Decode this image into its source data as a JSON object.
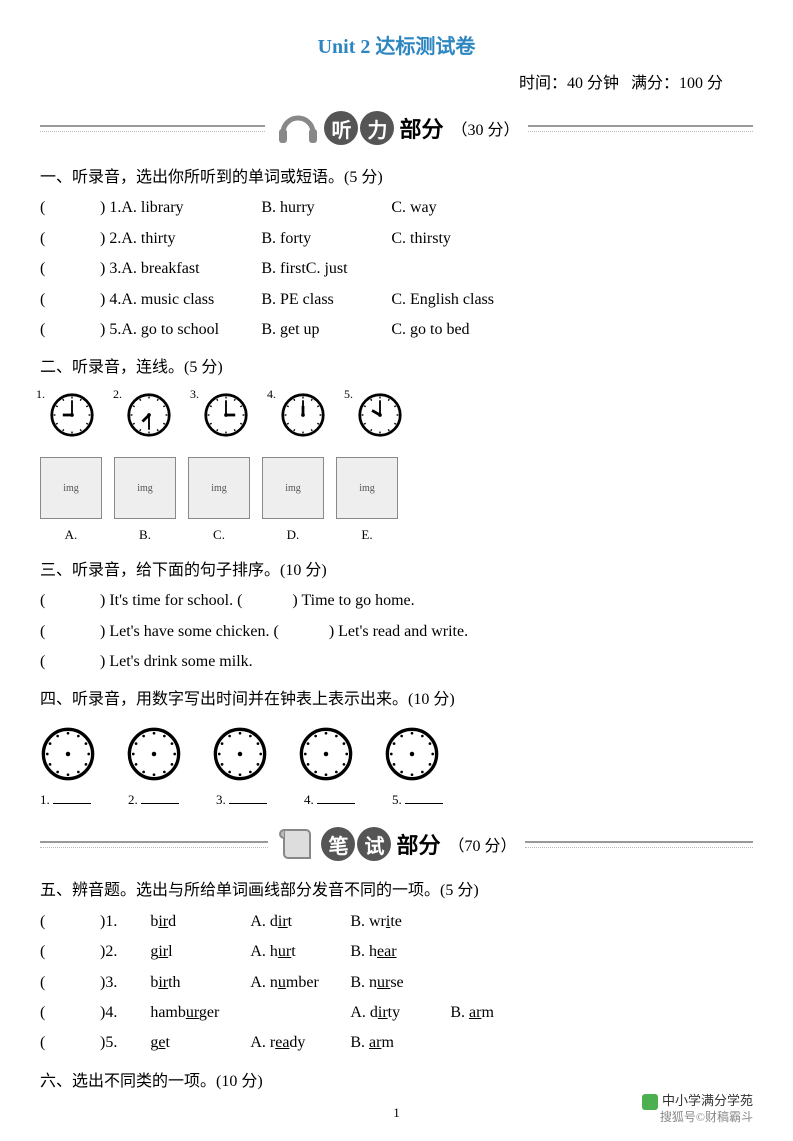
{
  "title": "Unit 2 达标测试卷",
  "meta": {
    "time_label": "时间：40 分钟",
    "score_label": "满分：100 分"
  },
  "listening": {
    "heading_bubbles": [
      "听",
      "力"
    ],
    "heading_text": "部分",
    "heading_points": "（30 分）",
    "q1": {
      "instruction": "一、听录音，选出你所听到的单词或短语。(5 分)",
      "items": [
        {
          "num": "1.",
          "a": "A. library",
          "b": "B. hurry",
          "c": "C. way"
        },
        {
          "num": "2.",
          "a": "A. thirty",
          "b": "B. forty",
          "c": "C. thirsty"
        },
        {
          "num": "3.",
          "a": "A. breakfast",
          "b": "B. firstC. just",
          "c": ""
        },
        {
          "num": "4.",
          "a": "A. music class",
          "b": "B. PE class",
          "c": "C. English class"
        },
        {
          "num": "5.",
          "a": "A. go to school",
          "b": "B. get up",
          "c": "C. go to bed"
        }
      ]
    },
    "q2": {
      "instruction": "二、听录音，连线。(5 分)",
      "clock_labels": [
        "1.",
        "2.",
        "3.",
        "4.",
        "5."
      ],
      "clock_times": [
        "9:00",
        "7:30",
        "3:00",
        "12:00",
        "10:00"
      ],
      "pic_labels": [
        "A.",
        "B.",
        "C.",
        "D.",
        "E."
      ]
    },
    "q3": {
      "instruction": "三、听录音，给下面的句子排序。(10 分)",
      "lines": [
        [
          ") It's time for school.  (",
          ") Time to go home."
        ],
        [
          ") Let's have some chicken.  (",
          ") Let's read and write."
        ],
        [
          ") Let's drink some milk."
        ]
      ]
    },
    "q4": {
      "instruction": "四、听录音，用数字写出时间并在钟表上表示出来。(10 分)",
      "num_labels": [
        "1.",
        "2.",
        "3.",
        "4.",
        "5."
      ]
    }
  },
  "written": {
    "heading_bubbles": [
      "笔",
      "试"
    ],
    "heading_text": "部分",
    "heading_points": "（70 分）",
    "q5": {
      "instruction": "五、辨音题。选出与所给单词画线部分发音不同的一项。(5 分)",
      "items": [
        {
          "num": "1.",
          "word_pre": "b",
          "word_u": "ir",
          "word_post": "d",
          "a_pre": "A. d",
          "a_u": "ir",
          "a_post": "t",
          "b_pre": "B. wr",
          "b_u": "i",
          "b_post": "te"
        },
        {
          "num": "2.",
          "word_pre": "g",
          "word_u": "ir",
          "word_post": "l",
          "a_pre": "A. h",
          "a_u": "ur",
          "a_post": "t",
          "b_pre": "B. h",
          "b_u": "ear",
          "b_post": ""
        },
        {
          "num": "3.",
          "word_pre": "b",
          "word_u": "ir",
          "word_post": "th",
          "a_pre": "A. n",
          "a_u": "u",
          "a_post": "mber",
          "b_pre": "B. n",
          "b_u": "ur",
          "b_post": "se"
        },
        {
          "num": "4.",
          "word_pre": "hamb",
          "word_u": "ur",
          "word_post": "ger",
          "a_pre": "A. d",
          "a_u": "ir",
          "a_post": "ty",
          "b_pre": "B. ",
          "b_u": "ar",
          "b_post": "m"
        },
        {
          "num": "5.",
          "word_pre": "g",
          "word_u": "e",
          "word_post": "t",
          "a_pre": "A. r",
          "a_u": "ea",
          "a_post": "dy",
          "b_pre": "B. ",
          "b_u": "ar",
          "b_post": "m"
        }
      ]
    },
    "q6": {
      "instruction": "六、选出不同类的一项。(10 分)"
    }
  },
  "page_number": "1",
  "watermark": {
    "line1": "中小学满分学苑",
    "line2": "搜狐号©财稿霸斗"
  }
}
